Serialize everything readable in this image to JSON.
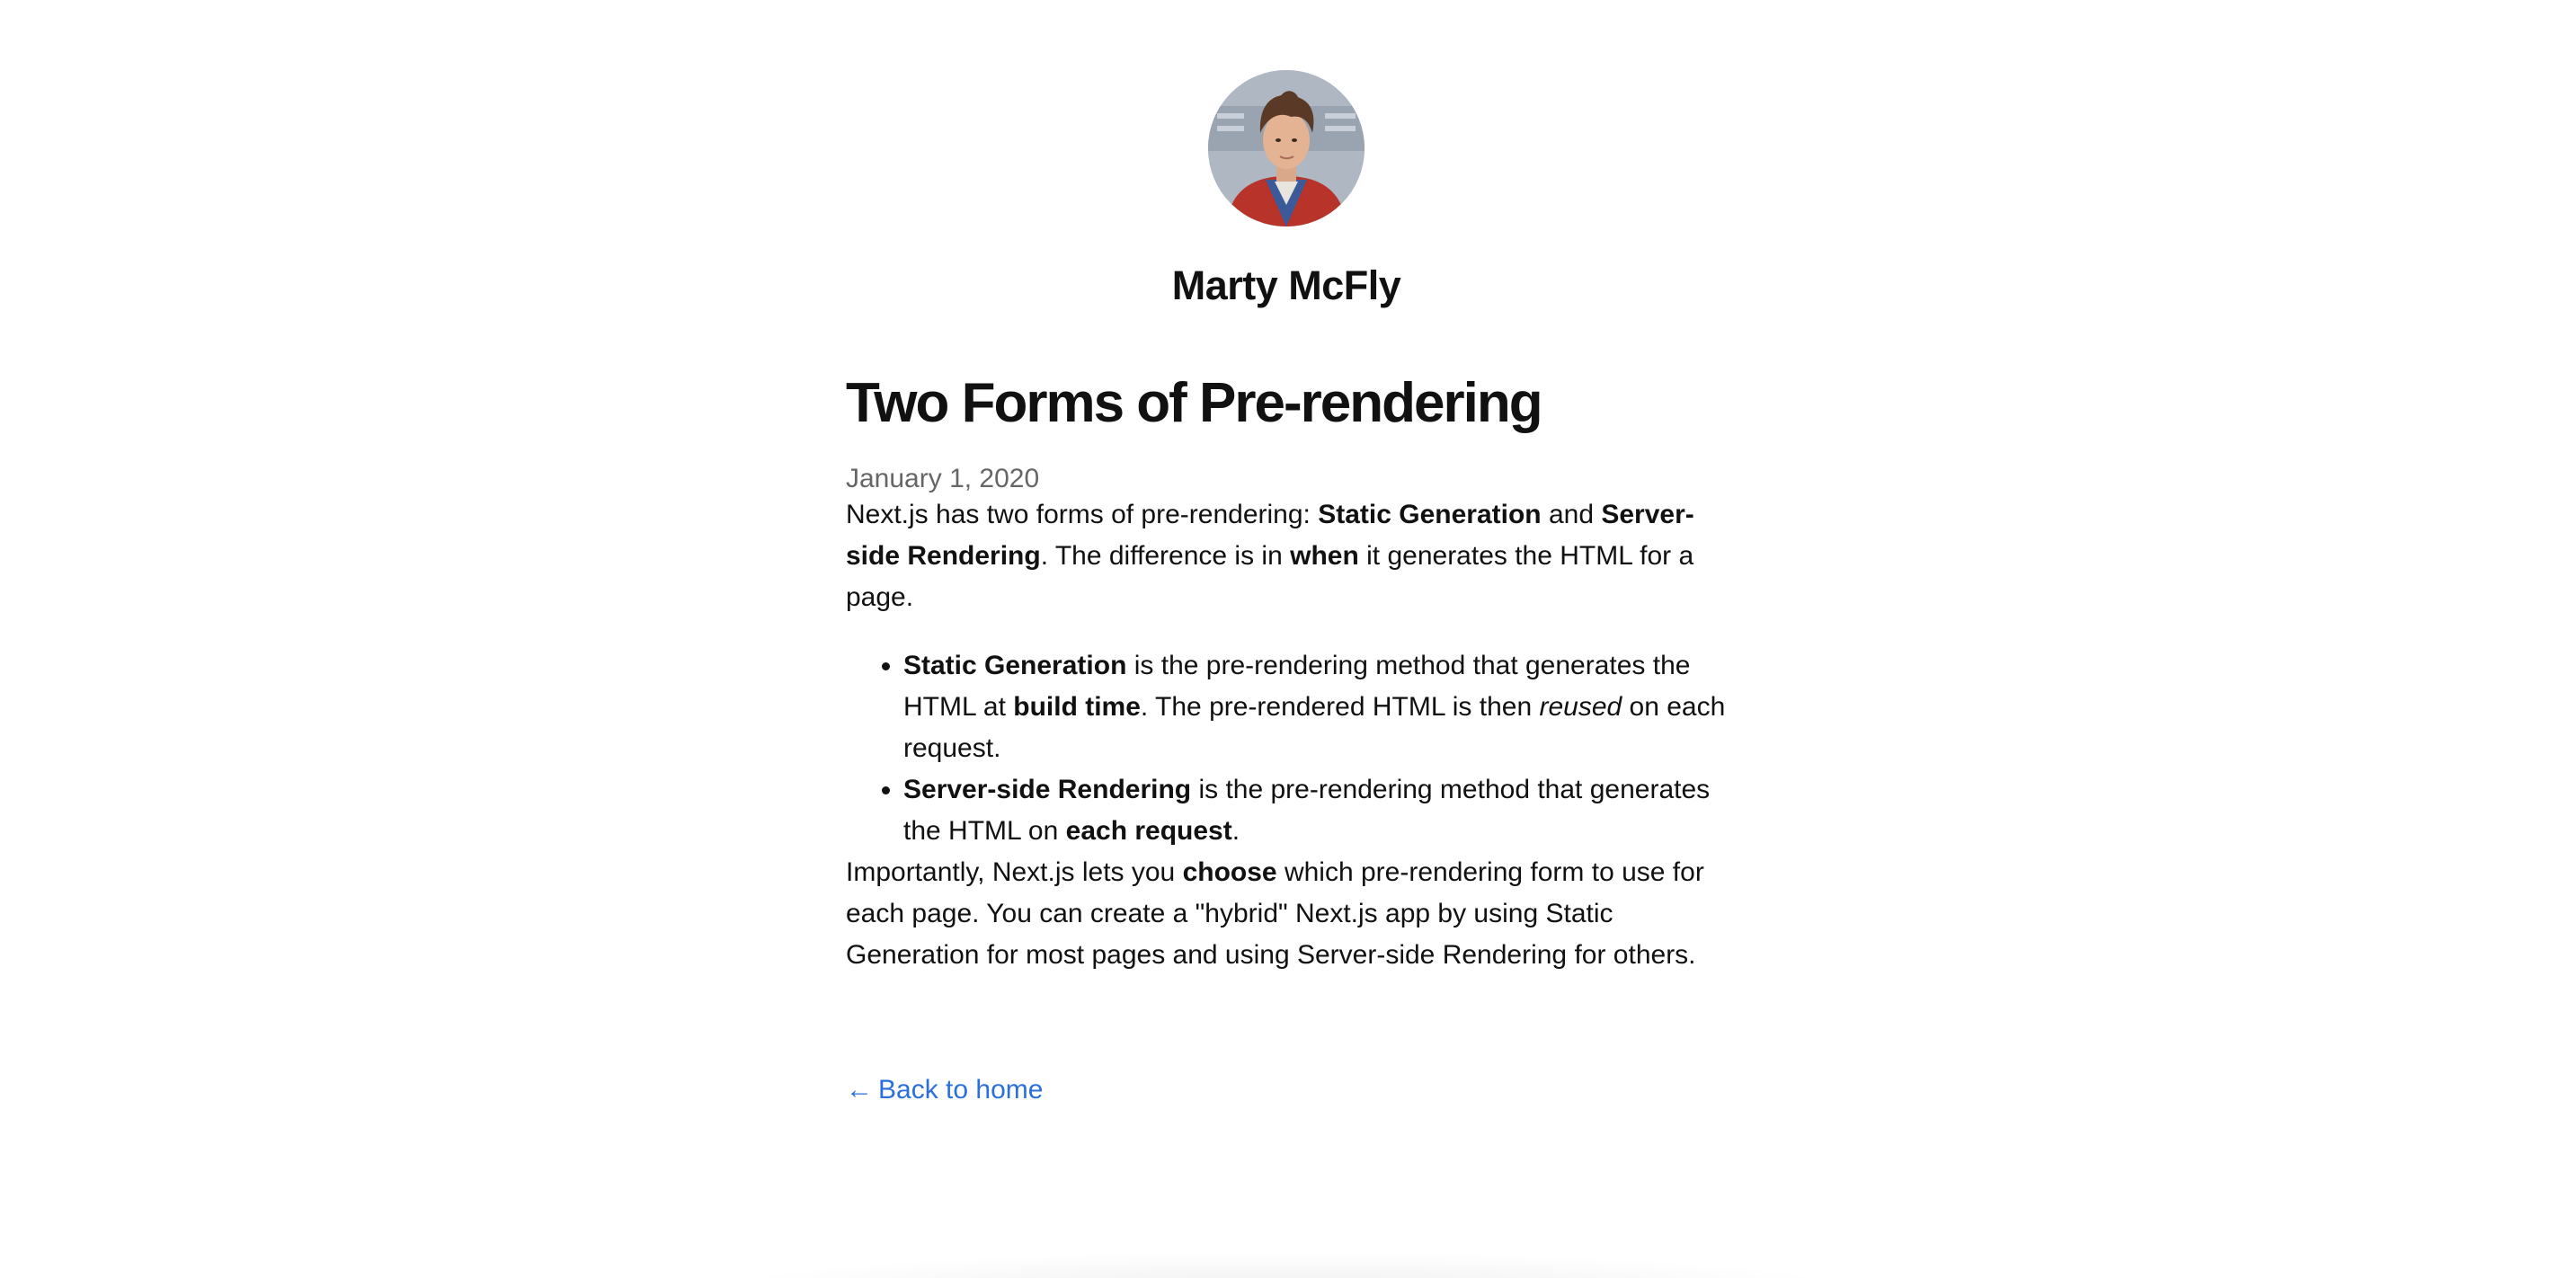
{
  "author": {
    "name": "Marty McFly",
    "avatar_icon": "profile-photo"
  },
  "post": {
    "title": "Two Forms of Pre-rendering",
    "date": "January 1, 2020",
    "intro": {
      "t1": "Next.js has two forms of pre-rendering: ",
      "b1": "Static Generation",
      "t2": " and ",
      "b2": "Server-side Rendering",
      "t3": ". The difference is in ",
      "b3": "when",
      "t4": " it generates the HTML for a page."
    },
    "bullets": [
      {
        "b1": "Static Generation",
        "t1": " is the pre-rendering method that generates the HTML at ",
        "b2": "build time",
        "t2": ". The pre-rendered HTML is then ",
        "i1": "reused",
        "t3": " on each request."
      },
      {
        "b1": "Server-side Rendering",
        "t1": " is the pre-rendering method that generates the HTML on ",
        "b2": "each request",
        "t2": "."
      }
    ],
    "closing": {
      "t1": "Importantly, Next.js lets you ",
      "b1": "choose",
      "t2": " which pre-rendering form to use for each page. You can create a \"hybrid\" Next.js app by using Static Generation for most pages and using Server-side Rendering for others."
    }
  },
  "nav": {
    "back_arrow": "←",
    "back_label": "Back to home",
    "link_color": "#2a6fdb"
  }
}
